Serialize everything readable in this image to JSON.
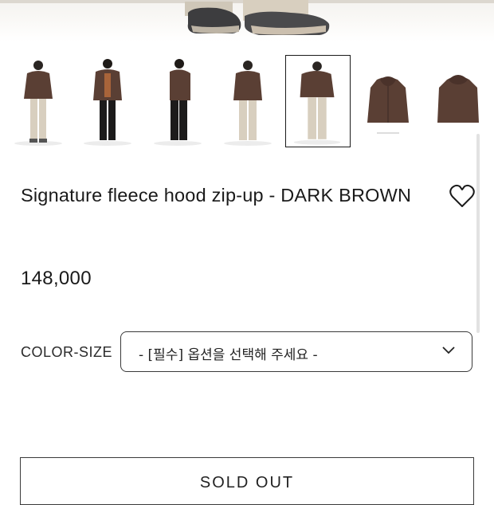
{
  "product": {
    "title": "Signature fleece hood zip-up - DARK BROWN",
    "price": "148,000",
    "wishlist_icon": "heart-icon"
  },
  "gallery": {
    "thumbnail_count": 7,
    "selected_index": 4
  },
  "option": {
    "label": "COLOR-SIZE",
    "placeholder": "- [필수] 옵션을 선택해 주세요 -",
    "icon": "chevron-down-icon"
  },
  "purchase": {
    "status_label": "SOLD OUT"
  },
  "colors": {
    "jacket": "#5a3f34",
    "pants_cream": "#d8cfbf",
    "pants_black": "#1c1b1b",
    "outline": "#1a1a1a"
  }
}
